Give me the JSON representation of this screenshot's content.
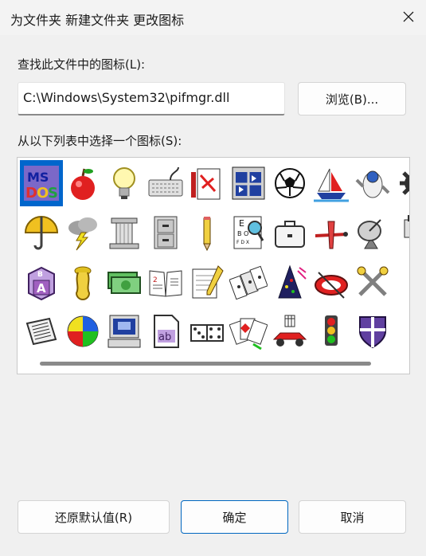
{
  "window": {
    "title": "为文件夹 新建文件夹 更改图标"
  },
  "search_label": "查找此文件中的图标(L):",
  "path_value": "C:\\Windows\\System32\\pifmgr.dll",
  "browse_button": "浏览(B)...",
  "list_label": "从以下列表中选择一个图标(S):",
  "icons": [
    "ms-dos-icon",
    "apple-icon",
    "light-bulb-icon",
    "keyboard-icon",
    "pencil-document-icon",
    "window-icon",
    "soccer-ball-icon",
    "sailboat-icon",
    "astronaut-icon",
    "gear-icon",
    "umbrella-icon",
    "storm-cloud-icon",
    "column-icon",
    "file-cabinet-icon",
    "pencil-icon",
    "eye-chart-icon",
    "briefcase-icon",
    "airplane-icon",
    "satellite-dish-icon",
    "plug-icon",
    "toy-block-icon",
    "trumpet-icon",
    "money-icon",
    "open-book-icon",
    "note-pencil-icon",
    "dominoes-icon",
    "party-hat-icon",
    "raft-icon",
    "crossed-tools-icon",
    "newspaper-icon",
    "beach-ball-icon",
    "computer-icon",
    "font-file-icon",
    "dice-icon",
    "playing-cards-icon",
    "race-car-icon",
    "traffic-light-icon",
    "shield-icon"
  ],
  "buttons": {
    "restore": "还原默认值(R)",
    "ok": "确定",
    "cancel": "取消"
  }
}
